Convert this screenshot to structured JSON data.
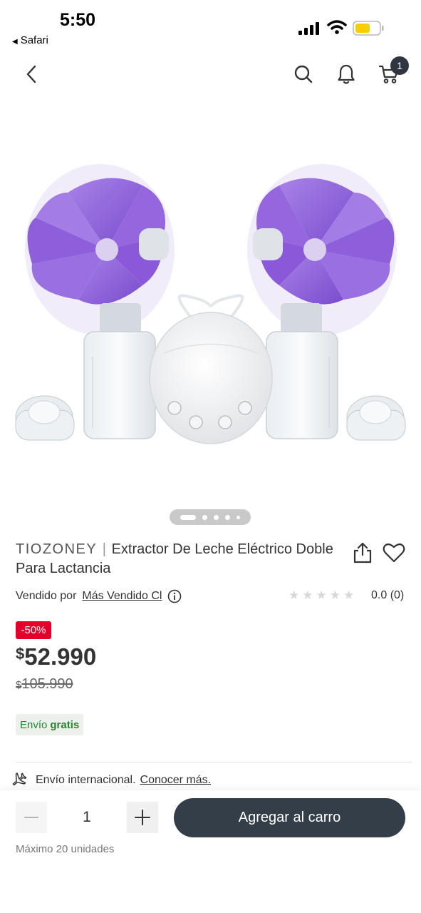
{
  "status_bar": {
    "time": "5:50",
    "back_app": "Safari",
    "back_arrow_icon": "left-triangle-icon",
    "battery_color": "#f5d000"
  },
  "nav": {
    "back_icon": "chevron-left-icon",
    "search_icon": "search-icon",
    "bell_icon": "bell-icon",
    "cart_icon": "cart-icon",
    "cart_count": "1"
  },
  "product": {
    "image_icon": "breast-pump-product-photo",
    "carousel": {
      "total": 5,
      "active": 1
    },
    "brand": "TIOZONEY",
    "separator": "|",
    "title": "Extractor De Leche Eléctrico Doble Para Lactancia",
    "seller_label": "Vendido por",
    "seller_name": "Más Vendido Cl",
    "rating_value": "0.0",
    "rating_count": "(0)",
    "rating_stars": 0,
    "discount": "-50%",
    "currency": "$",
    "price": "52.990",
    "old_price": "105.990",
    "shipping_label": "Envío",
    "shipping_value": "gratis"
  },
  "international": {
    "text": "Envío internacional.",
    "link": "Conocer más."
  },
  "bottom_bar": {
    "quantity": "1",
    "add_to_cart": "Agregar al carro",
    "max_units": "Máximo 20 unidades"
  },
  "colors": {
    "discount_red": "#e4002b",
    "button_dark": "#343e48",
    "shipping_green": "#1a8a34"
  }
}
